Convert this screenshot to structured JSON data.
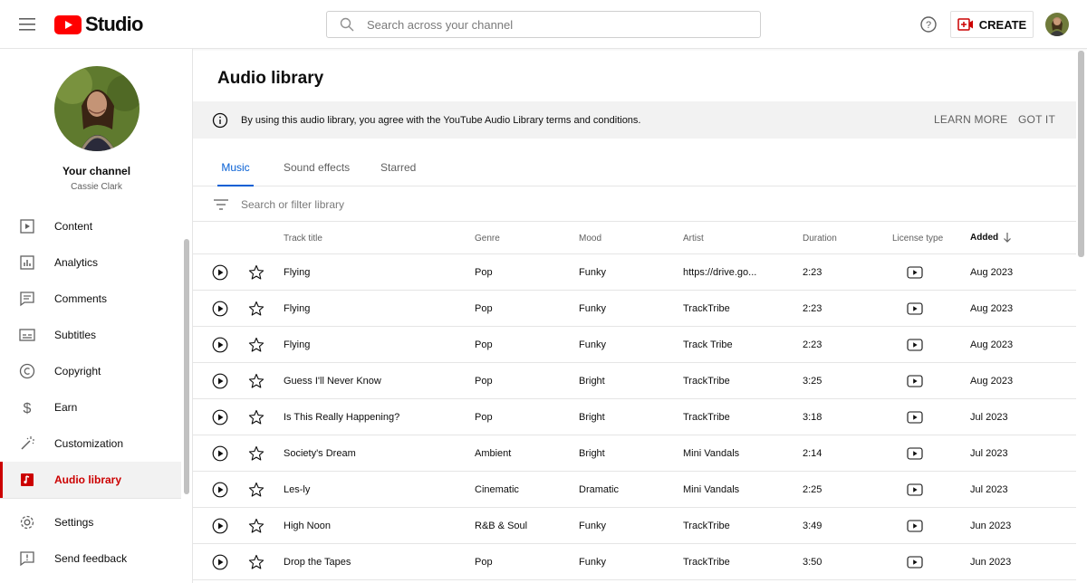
{
  "header": {
    "logo_text": "Studio",
    "search_placeholder": "Search across your channel",
    "create_label": "CREATE",
    "brand_color": "#ff0000"
  },
  "sidebar": {
    "channel_title": "Your channel",
    "channel_name": "Cassie Clark",
    "items": [
      {
        "label": "Content",
        "icon": "content-icon"
      },
      {
        "label": "Analytics",
        "icon": "analytics-icon"
      },
      {
        "label": "Comments",
        "icon": "comments-icon"
      },
      {
        "label": "Subtitles",
        "icon": "subtitles-icon"
      },
      {
        "label": "Copyright",
        "icon": "copyright-icon"
      },
      {
        "label": "Earn",
        "icon": "dollar-icon"
      },
      {
        "label": "Customization",
        "icon": "magic-wand-icon"
      },
      {
        "label": "Audio library",
        "icon": "audio-library-icon",
        "active": true
      }
    ],
    "bottom_items": [
      {
        "label": "Settings",
        "icon": "gear-icon"
      },
      {
        "label": "Send feedback",
        "icon": "feedback-icon"
      }
    ]
  },
  "main": {
    "title": "Audio library",
    "banner": {
      "text": "By using this audio library, you agree with the YouTube Audio Library terms and conditions.",
      "learn_more": "LEARN MORE",
      "got_it": "GOT IT"
    },
    "tabs": [
      {
        "label": "Music",
        "active": true
      },
      {
        "label": "Sound effects"
      },
      {
        "label": "Starred"
      }
    ],
    "filter_placeholder": "Search or filter library",
    "columns": {
      "track_title": "Track title",
      "genre": "Genre",
      "mood": "Mood",
      "artist": "Artist",
      "duration": "Duration",
      "license_type": "License type",
      "added": "Added"
    },
    "rows": [
      {
        "title": "Flying",
        "genre": "Pop",
        "mood": "Funky",
        "artist": "https://drive.go...",
        "duration": "2:23",
        "added": "Aug 2023"
      },
      {
        "title": "Flying",
        "genre": "Pop",
        "mood": "Funky",
        "artist": "TrackTribe",
        "duration": "2:23",
        "added": "Aug 2023"
      },
      {
        "title": "Flying",
        "genre": "Pop",
        "mood": "Funky",
        "artist": "Track Tribe",
        "duration": "2:23",
        "added": "Aug 2023"
      },
      {
        "title": "Guess I'll Never Know",
        "genre": "Pop",
        "mood": "Bright",
        "artist": "TrackTribe",
        "duration": "3:25",
        "added": "Aug 2023"
      },
      {
        "title": "Is This Really Happening?",
        "genre": "Pop",
        "mood": "Bright",
        "artist": "TrackTribe",
        "duration": "3:18",
        "added": "Jul 2023"
      },
      {
        "title": "Society's Dream",
        "genre": "Ambient",
        "mood": "Bright",
        "artist": "Mini Vandals",
        "duration": "2:14",
        "added": "Jul 2023"
      },
      {
        "title": "Les-ly",
        "genre": "Cinematic",
        "mood": "Dramatic",
        "artist": "Mini Vandals",
        "duration": "2:25",
        "added": "Jul 2023"
      },
      {
        "title": "High Noon",
        "genre": "R&B & Soul",
        "mood": "Funky",
        "artist": "TrackTribe",
        "duration": "3:49",
        "added": "Jun 2023"
      },
      {
        "title": "Drop the Tapes",
        "genre": "Pop",
        "mood": "Funky",
        "artist": "TrackTribe",
        "duration": "3:50",
        "added": "Jun 2023"
      }
    ]
  }
}
